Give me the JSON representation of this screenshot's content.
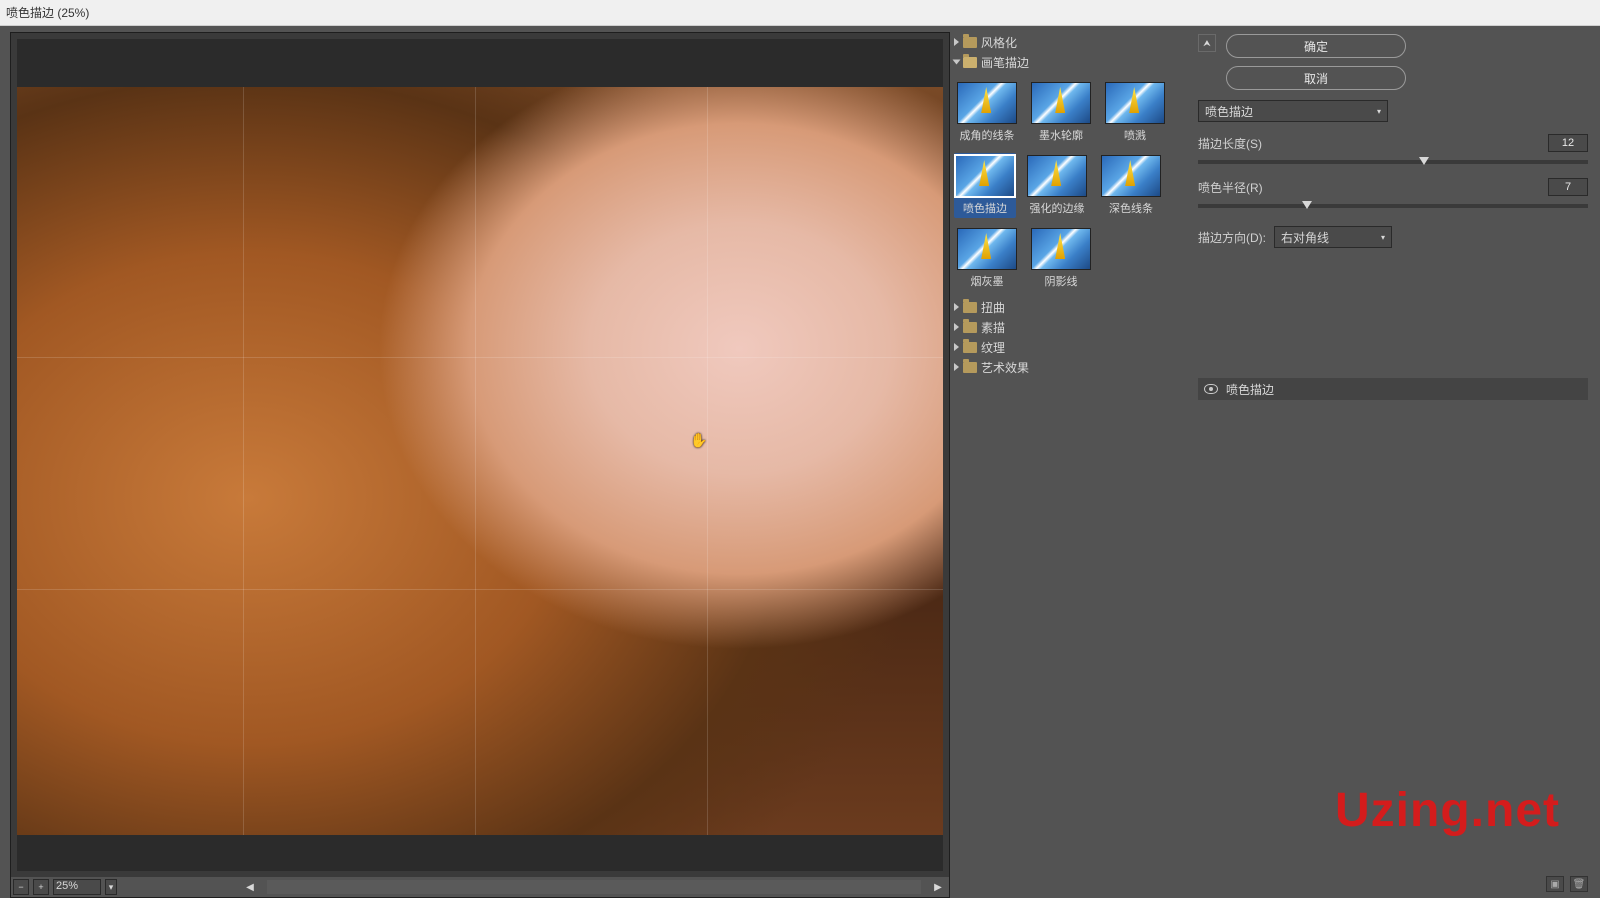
{
  "window_title": "喷色描边 (25%)",
  "zoom_level": "25%",
  "watermark": "Uzing.net",
  "categories": [
    {
      "label": "风格化",
      "expanded": false
    },
    {
      "label": "画笔描边",
      "expanded": true,
      "presets": [
        {
          "label": "成角的线条"
        },
        {
          "label": "墨水轮廓"
        },
        {
          "label": "喷溅"
        },
        {
          "label": "喷色描边",
          "selected": true
        },
        {
          "label": "强化的边缘"
        },
        {
          "label": "深色线条"
        },
        {
          "label": "烟灰墨"
        },
        {
          "label": "阴影线"
        }
      ]
    },
    {
      "label": "扭曲",
      "expanded": false
    },
    {
      "label": "素描",
      "expanded": false
    },
    {
      "label": "纹理",
      "expanded": false
    },
    {
      "label": "艺术效果",
      "expanded": false
    }
  ],
  "buttons": {
    "ok": "确定",
    "cancel": "取消"
  },
  "filter_select": "喷色描边",
  "params": {
    "stroke_length": {
      "label": "描边长度(S)",
      "value": "12",
      "pct": 58
    },
    "spray_radius": {
      "label": "喷色半径(R)",
      "value": "7",
      "pct": 28
    },
    "direction": {
      "label": "描边方向(D):",
      "value": "右对角线"
    }
  },
  "layer": {
    "name": "喷色描边"
  }
}
